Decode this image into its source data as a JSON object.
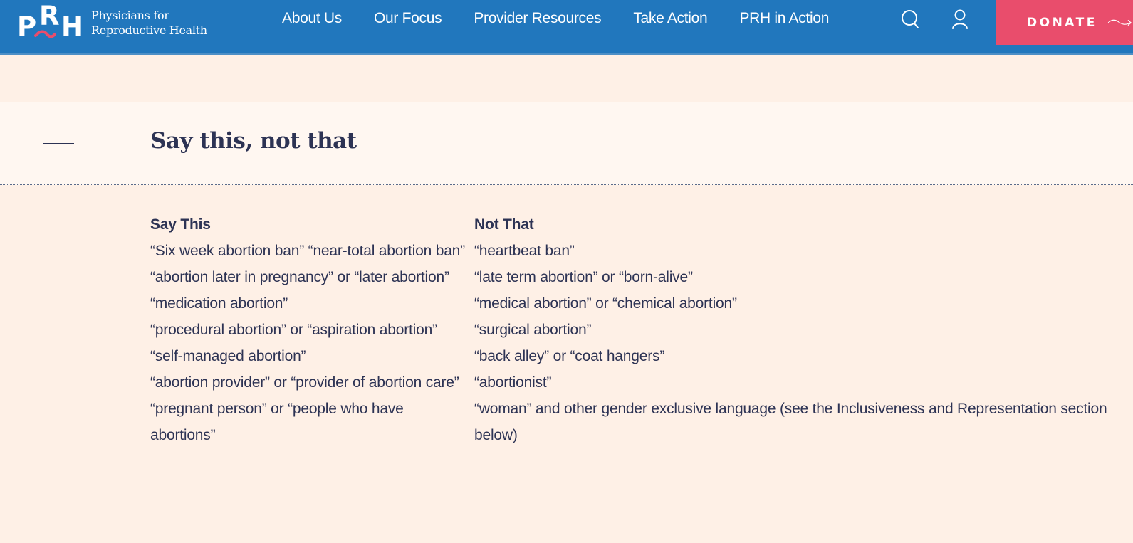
{
  "header": {
    "logo": {
      "mark_letters": [
        "P",
        "R",
        "H"
      ],
      "line1": "Physicians for",
      "line2": "Reproductive Health"
    },
    "nav": [
      "About Us",
      "Our Focus",
      "Provider Resources",
      "Take Action",
      "PRH in Action"
    ],
    "icons": {
      "search": "search-icon",
      "account": "user-icon"
    },
    "donate_label": "DONATE",
    "colors": {
      "header_bg": "#2177bd",
      "donate_bg": "#e94d6c",
      "accent_wave": "#e94d6c"
    }
  },
  "section": {
    "title": "Say this, not that",
    "toggle_icon": "minus-icon",
    "table": {
      "headers": [
        "Say This",
        "Not That"
      ],
      "rows": [
        [
          "“Six week abortion ban” “near-total abortion ban”",
          "“heartbeat ban”"
        ],
        [
          "“abortion later in pregnancy” or “later abortion”",
          "“late term abortion”  or “born-alive”"
        ],
        [
          "“medication abortion”",
          "“medical abortion” or “chemical abortion”"
        ],
        [
          "“procedural abortion” or “aspiration abortion”",
          "“surgical abortion”"
        ],
        [
          "“self-managed abortion”",
          "“back alley” or “coat hangers”"
        ],
        [
          "“abortion provider” or “provider of abortion care”",
          "“abortionist”"
        ],
        [
          "“pregnant person” or “people who have abortions”",
          "“woman” and other gender exclusive language (see the Inclusiveness and Representation section below)"
        ]
      ]
    }
  }
}
